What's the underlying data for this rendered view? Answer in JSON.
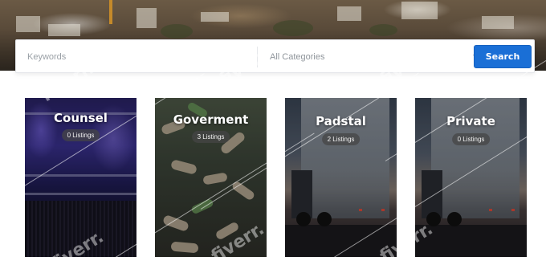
{
  "search": {
    "keywords_placeholder": "Keywords",
    "category_selected": "All Categories",
    "button_label": "Search"
  },
  "categories": [
    {
      "name": "Counsel",
      "count_label": "0 Listings"
    },
    {
      "name": "Goverment",
      "count_label": "3 Listings"
    },
    {
      "name": "Padstal",
      "count_label": "2 Listings"
    },
    {
      "name": "Private",
      "count_label": "0 Listings"
    }
  ],
  "watermark": "fiverr.",
  "colors": {
    "search_button": "#1a6fd6",
    "badge_bg": "#464646",
    "title_text": "#ffffff"
  }
}
